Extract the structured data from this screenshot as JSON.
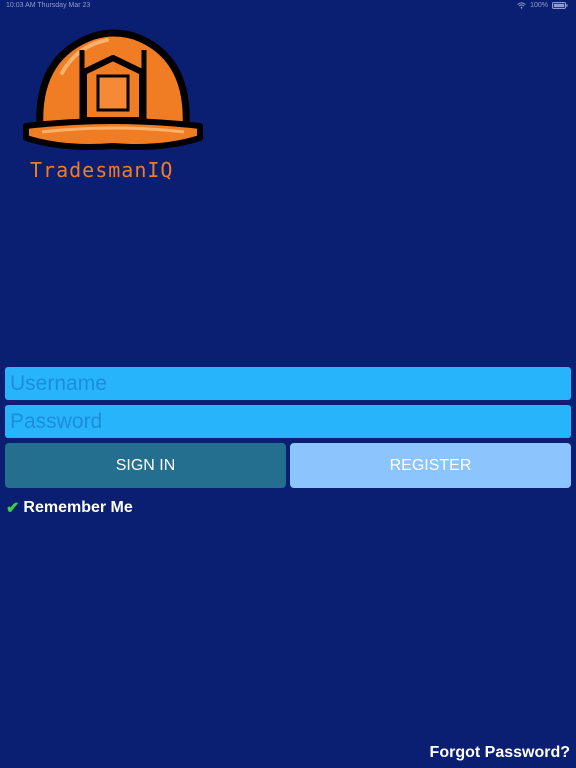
{
  "status_bar": {
    "time_date": "10:03 AM   Thursday Mar 23",
    "battery": "100%"
  },
  "logo": {
    "text": "TradesmanIQ",
    "icon": "hard-hat-icon",
    "colors": {
      "helmet": "#f07c24",
      "outline": "#000000"
    }
  },
  "login": {
    "username_placeholder": "Username",
    "password_placeholder": "Password",
    "sign_in_label": "SIGN IN",
    "register_label": "REGISTER",
    "remember_label": "Remember Me",
    "remember_checked": true
  },
  "footer": {
    "forgot_label": "Forgot Password?"
  },
  "colors": {
    "background": "#0b1f72",
    "field": "#28b4fb",
    "sign_in": "#246e8f",
    "register": "#8cc4fd",
    "check": "#3ad14a"
  }
}
